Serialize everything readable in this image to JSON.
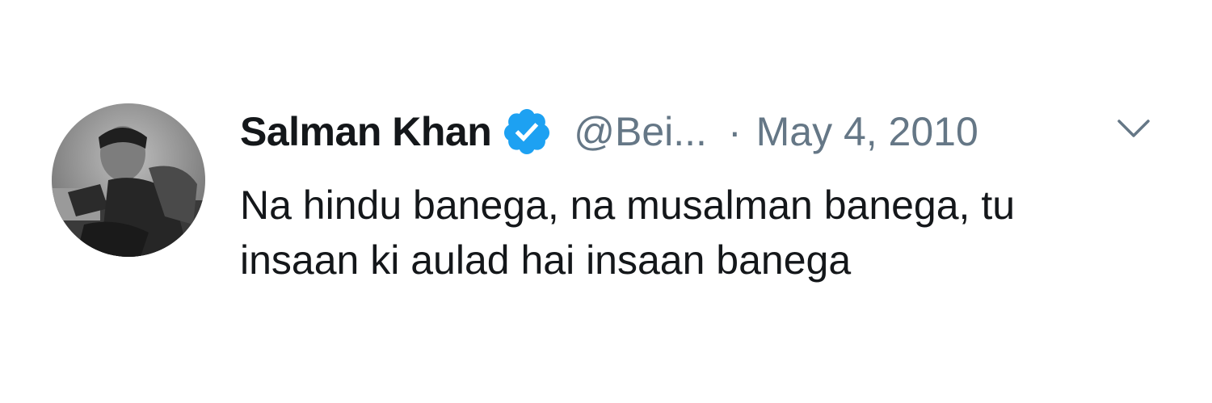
{
  "tweet": {
    "display_name": "Salman Khan",
    "verified_icon": "verified-badge-icon",
    "handle": "@Bei...",
    "separator": "·",
    "timestamp": "May 4, 2010",
    "menu_icon": "chevron-down-icon",
    "text_lines": [
      "Na hindu banega, na musalman banega, tu",
      "insaan ki aulad hai insaan banega"
    ]
  },
  "colors": {
    "name": "#14171a",
    "secondary": "#657786",
    "verified": "#1da1f2",
    "background": "#ffffff"
  }
}
